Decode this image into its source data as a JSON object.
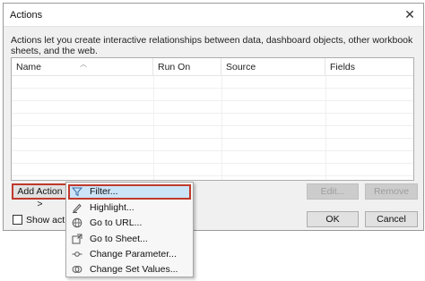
{
  "dialog": {
    "title": "Actions",
    "close_glyph": "✕",
    "description": "Actions let you create interactive relationships between data, dashboard objects, other workbook sheets, and the web."
  },
  "table": {
    "columns": [
      "Name",
      "Run On",
      "Source",
      "Fields"
    ],
    "sorted_column": "Name",
    "rows": []
  },
  "buttons": {
    "add_action": "Add Action >",
    "edit": "Edit...",
    "remove": "Remove",
    "ok": "OK",
    "cancel": "Cancel"
  },
  "show_actions": {
    "label": "Show actions",
    "checked": false
  },
  "add_action_menu": {
    "items": [
      {
        "label": "Filter...",
        "icon": "filter-icon",
        "active": true
      },
      {
        "label": "Highlight...",
        "icon": "highlight-icon",
        "active": false
      },
      {
        "label": "Go to URL...",
        "icon": "globe-icon",
        "active": false
      },
      {
        "label": "Go to Sheet...",
        "icon": "go-to-sheet-icon",
        "active": false
      },
      {
        "label": "Change Parameter...",
        "icon": "parameter-icon",
        "active": false
      },
      {
        "label": "Change Set Values...",
        "icon": "set-values-icon",
        "active": false
      }
    ]
  },
  "colors": {
    "highlight_outline": "#c0392b",
    "menu_selected": "#cce4f7"
  }
}
